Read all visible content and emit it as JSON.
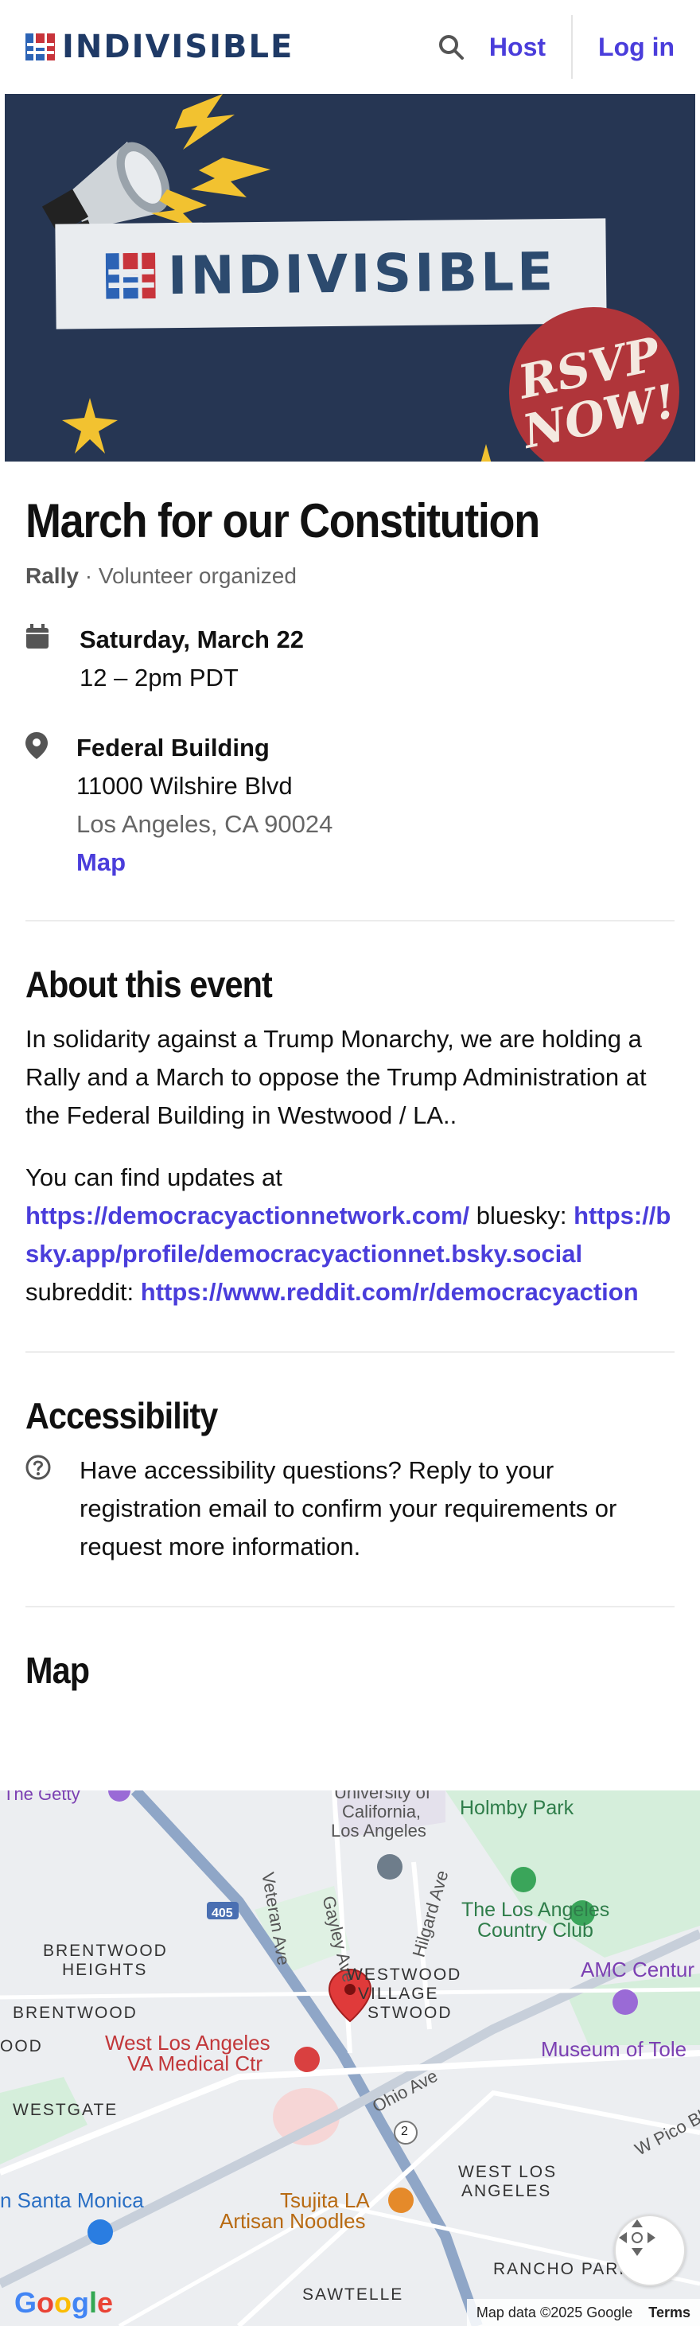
{
  "header": {
    "logo_text": "INDIVISIBLE",
    "search_icon": "search-icon",
    "host_label": "Host",
    "login_label": "Log in"
  },
  "hero": {
    "banner_text": "INDIVISIBLE",
    "rsvp_line1": "RSVP",
    "rsvp_line2": "NOW!"
  },
  "event": {
    "title": "March for our Constitution",
    "type": "Rally",
    "organizer": "Volunteer organized",
    "date": "Saturday, March 22",
    "time": "12 – 2pm PDT",
    "venue": "Federal Building",
    "street": "11000 Wilshire Blvd",
    "city": "Los Angeles, CA 90024",
    "map_link": "Map"
  },
  "about": {
    "heading": "About this event",
    "para1": "In solidarity against a Trump Monarchy, we are holding a Rally and a March to oppose the Trump Administration at the Federal Building in Westwood / LA..",
    "para2_prefix": "You can find updates at",
    "link1": "https://democracyactionnetwork.com/",
    "label_bluesky": "bluesky:",
    "link2": "https://bsky.app/profile/democracyactionnet.bsky.social",
    "label_subreddit": "subreddit:",
    "link3": "https://www.reddit.com/r/democracyaction"
  },
  "accessibility": {
    "heading": "Accessibility",
    "text": "Have accessibility questions? Reply to your registration email to confirm your requirements or request more information."
  },
  "map": {
    "heading": "Map",
    "labels": {
      "getty": "The Getty",
      "ucla1": "University of",
      "ucla2": "California,",
      "ucla3": "Los Angeles",
      "holmby": "Holmby Park",
      "brentwood_heights1": "BRENTWOOD",
      "brentwood_heights2": "HEIGHTS",
      "brentwood": "BRENTWOOD",
      "veteran": "Veteran Ave",
      "gayley": "Gayley Ave",
      "hilgard": "Hilgard Ave",
      "country_club1": "The Los Angeles",
      "country_club2": "Country Club",
      "amc": "AMC Centur",
      "westwood1": "WESTWOOD",
      "westwood2": "VILLAGE",
      "westwood3": "STWOOD",
      "ood": "OOD",
      "va1": "West Los Angeles",
      "va2": "VA Medical Ctr",
      "museum": "Museum of Tole",
      "ohio": "Ohio Ave",
      "westgate": "WESTGATE",
      "wpico": "W Pico Bl",
      "west_la1": "WEST LOS",
      "west_la2": "ANGELES",
      "santa_monica": "n Santa Monica",
      "tsujita1": "Tsujita LA",
      "tsujita2": "Artisan Noodles",
      "rancho": "RANCHO PARK",
      "sawtelle": "SAWTELLE",
      "route405": "405",
      "route2": "2"
    },
    "google": "Google",
    "map_data": "Map data ©2025 Google",
    "terms": "Terms"
  },
  "colors": {
    "accent": "#4a3ddb",
    "navy": "#263653",
    "brand": "#1f3a66",
    "rsvp_red": "#b0353a"
  }
}
